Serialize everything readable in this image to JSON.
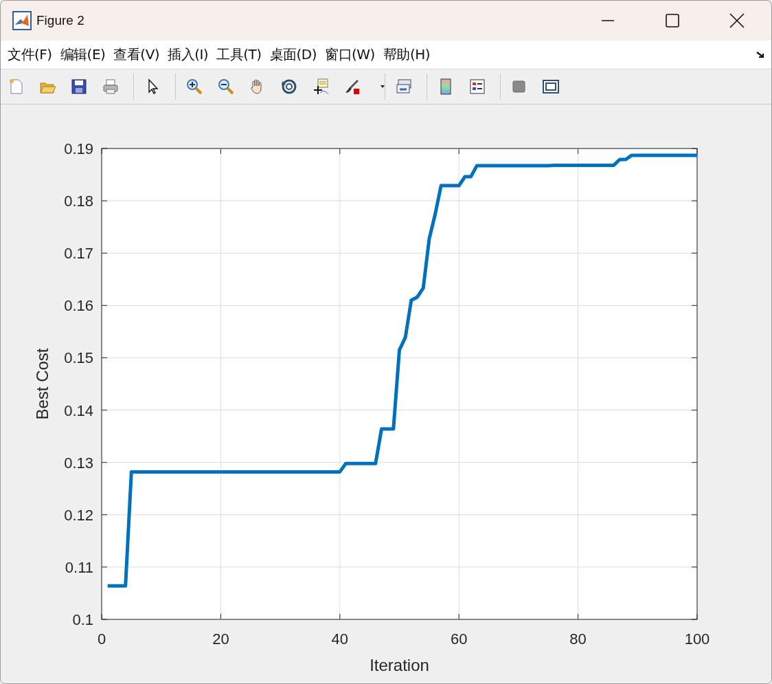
{
  "window": {
    "title": "Figure 2"
  },
  "menu": [
    "文件(F)",
    "编辑(E)",
    "查看(V)",
    "插入(I)",
    "工具(T)",
    "桌面(D)",
    "窗口(W)",
    "帮助(H)"
  ],
  "figure": {
    "chart_data": {
      "type": "line",
      "grid": true,
      "xlabel": "Iteration",
      "ylabel": "Best Cost",
      "xlim": [
        0,
        100
      ],
      "ylim": [
        0.1,
        0.19
      ],
      "xticks": [
        0,
        20,
        40,
        60,
        80,
        100
      ],
      "yticks": [
        {
          "value": 0.1,
          "label": "0.1"
        },
        {
          "value": 0.11,
          "label": "0.11"
        },
        {
          "value": 0.12,
          "label": "0.12"
        },
        {
          "value": 0.13,
          "label": "0.13"
        },
        {
          "value": 0.14,
          "label": "0.14"
        },
        {
          "value": 0.15,
          "label": "0.15"
        },
        {
          "value": 0.16,
          "label": "0.16"
        },
        {
          "value": 0.17,
          "label": "0.17"
        },
        {
          "value": 0.18,
          "label": "0.18"
        },
        {
          "value": 0.19,
          "label": "0.19"
        }
      ],
      "x": [
        1,
        2,
        3,
        4,
        5,
        6,
        7,
        8,
        9,
        10,
        11,
        12,
        13,
        14,
        15,
        16,
        17,
        18,
        19,
        20,
        21,
        22,
        23,
        24,
        25,
        26,
        27,
        28,
        29,
        30,
        31,
        32,
        33,
        34,
        35,
        36,
        37,
        38,
        39,
        40,
        41,
        42,
        43,
        44,
        45,
        46,
        47,
        48,
        49,
        50,
        51,
        52,
        53,
        54,
        55,
        56,
        57,
        58,
        59,
        60,
        61,
        62,
        63,
        64,
        65,
        66,
        67,
        68,
        69,
        70,
        71,
        72,
        73,
        74,
        75,
        76,
        77,
        78,
        79,
        80,
        81,
        82,
        83,
        84,
        85,
        86,
        87,
        88,
        89,
        90,
        91,
        92,
        93,
        94,
        95,
        96,
        97,
        98,
        99,
        100
      ],
      "series": [
        {
          "color": "#0072bd",
          "values": [
            0.1064,
            0.1064,
            0.1064,
            0.1064,
            0.1282,
            0.1282,
            0.1282,
            0.1282,
            0.1282,
            0.1282,
            0.1282,
            0.1282,
            0.1282,
            0.1282,
            0.1282,
            0.1282,
            0.1282,
            0.1282,
            0.1282,
            0.1282,
            0.1282,
            0.1282,
            0.1282,
            0.1282,
            0.1282,
            0.1282,
            0.1282,
            0.1282,
            0.1282,
            0.1282,
            0.1282,
            0.1282,
            0.1282,
            0.1282,
            0.1282,
            0.1282,
            0.1282,
            0.1282,
            0.1282,
            0.1282,
            0.1298,
            0.1298,
            0.1298,
            0.1298,
            0.1298,
            0.1298,
            0.1364,
            0.1364,
            0.1364,
            0.1515,
            0.1539,
            0.161,
            0.1616,
            0.1633,
            0.1727,
            0.1774,
            0.1829,
            0.1829,
            0.1829,
            0.1829,
            0.1846,
            0.1846,
            0.1867,
            0.1867,
            0.1867,
            0.1867,
            0.1867,
            0.1867,
            0.1867,
            0.1867,
            0.1867,
            0.1867,
            0.1867,
            0.1867,
            0.1867,
            0.1868,
            0.1868,
            0.1868,
            0.1868,
            0.1868,
            0.1868,
            0.1868,
            0.1868,
            0.1868,
            0.1868,
            0.1868,
            0.1879,
            0.1879,
            0.1887,
            0.1887,
            0.1887,
            0.1887,
            0.1887,
            0.1887,
            0.1887,
            0.1887,
            0.1887,
            0.1887,
            0.1887,
            0.1887
          ]
        }
      ]
    }
  }
}
